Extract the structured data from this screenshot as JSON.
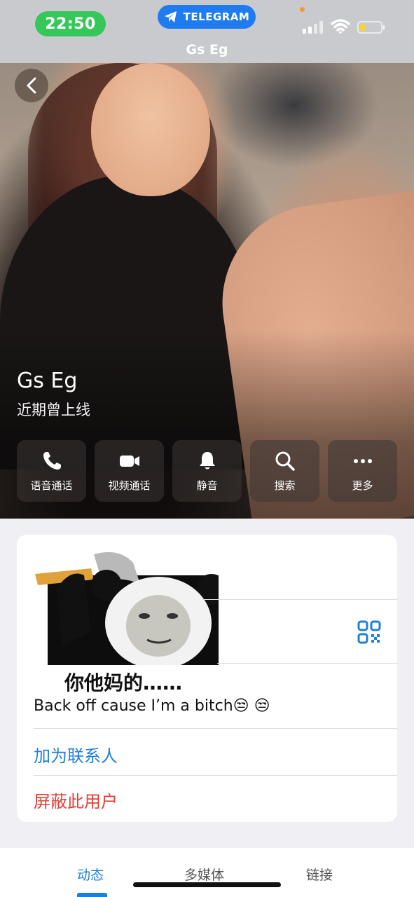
{
  "status_bar": {
    "time": "22:50",
    "app_pill": "TELEGRAM",
    "colors": {
      "time_pill": "#35c759",
      "app_pill": "#1e7bf0"
    }
  },
  "header": {
    "title": "Gs Eg"
  },
  "profile": {
    "name": "Gs Eg",
    "status": "近期曾上线"
  },
  "actions": [
    {
      "label": "语音通话",
      "icon": "phone-icon"
    },
    {
      "label": "视频通话",
      "icon": "video-icon"
    },
    {
      "label": "静音",
      "icon": "bell-icon"
    },
    {
      "label": "搜索",
      "icon": "search-icon"
    },
    {
      "label": "更多",
      "icon": "more-icon"
    }
  ],
  "bio": {
    "meme_caption": "你他妈的……",
    "text": "Back off cause I’m a bitch😒 😒"
  },
  "menu": {
    "add_contact": "加为联系人",
    "block_user": "屏蔽此用户"
  },
  "tabs": [
    {
      "label": "动态",
      "active": true
    },
    {
      "label": "多媒体",
      "active": false
    },
    {
      "label": "链接",
      "active": false
    }
  ],
  "accent_color": "#1f7fd8",
  "danger_color": "#e1413a"
}
